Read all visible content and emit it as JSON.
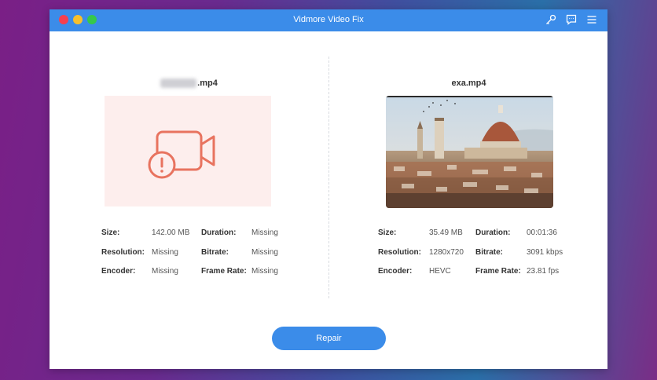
{
  "window": {
    "title": "Vidmore Video Fix"
  },
  "colors": {
    "accent": "#3b8ce9",
    "error": "#e8735f",
    "error_bg": "#fdeeed"
  },
  "toolbar_icons": [
    "key-icon",
    "feedback-icon",
    "menu-icon"
  ],
  "left": {
    "filename_suffix": ".mp4",
    "preview_icon": "broken-video-icon",
    "info": {
      "size_label": "Size:",
      "size": "142.00 MB",
      "duration_label": "Duration:",
      "duration": "Missing",
      "resolution_label": "Resolution:",
      "resolution": "Missing",
      "bitrate_label": "Bitrate:",
      "bitrate": "Missing",
      "encoder_label": "Encoder:",
      "encoder": "Missing",
      "framerate_label": "Frame Rate:",
      "framerate": "Missing"
    }
  },
  "right": {
    "filename": "exa.mp4",
    "info": {
      "size_label": "Size:",
      "size": "35.49 MB",
      "duration_label": "Duration:",
      "duration": "00:01:36",
      "resolution_label": "Resolution:",
      "resolution": "1280x720",
      "bitrate_label": "Bitrate:",
      "bitrate": "3091 kbps",
      "encoder_label": "Encoder:",
      "encoder": "HEVC",
      "framerate_label": "Frame Rate:",
      "framerate": "23.81 fps"
    }
  },
  "repair_button": {
    "label": "Repair"
  }
}
